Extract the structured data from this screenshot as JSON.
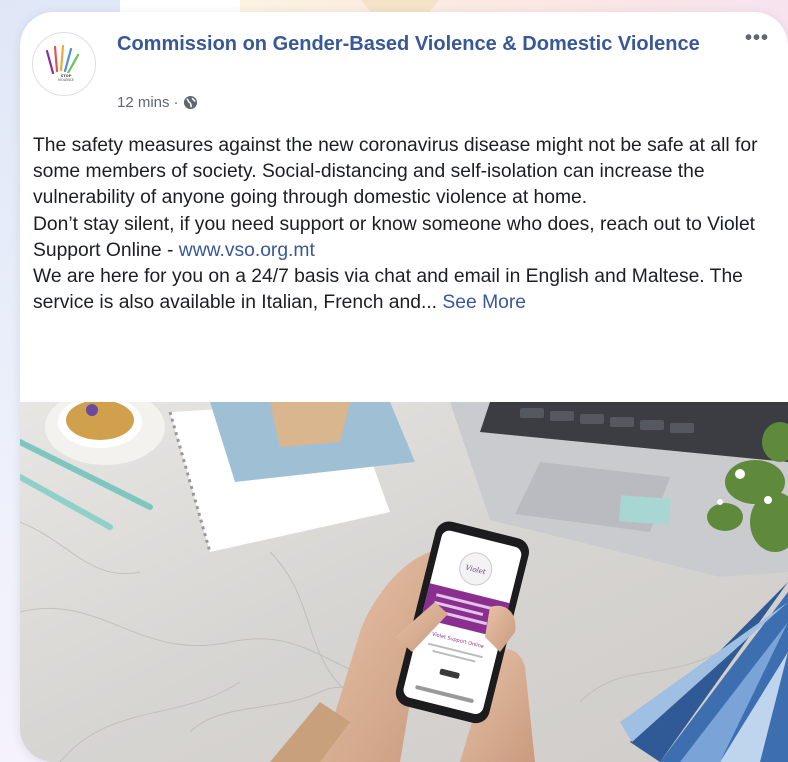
{
  "post": {
    "page_name": "Commission on Gender-Based Violence & Domestic Violence",
    "timestamp": "12 mins",
    "separator": "·",
    "privacy_icon": "globe-icon",
    "more_label": "•••",
    "paragraph_1": "The safety measures against the new coronavirus disease might not be safe at all for some members of society. Social-distancing and self-isolation can increase the vulnerability of anyone going through domestic violence at home.",
    "paragraph_2_text": "Don’t stay silent, if you need support or know someone who does, reach out to Violet Support Online - ",
    "paragraph_2_link": "www.vso.org.mt",
    "paragraph_3_text": "We are here for you on a 24/7 basis via chat and email in English and Maltese. The service is also available in Italian, French and... ",
    "see_more": "See More",
    "avatar_logo_text": "STOP VIOLENCE",
    "phone_screen_title": "Violet Support Online"
  },
  "colors": {
    "link": "#385898",
    "text": "#1c1e21",
    "meta": "#616770",
    "phone_accent": "#8a2f8f"
  }
}
